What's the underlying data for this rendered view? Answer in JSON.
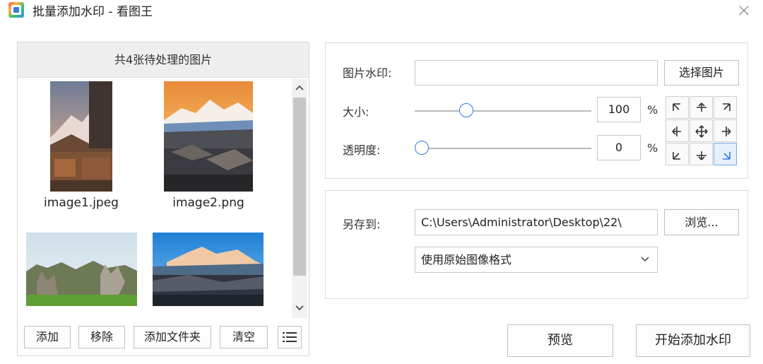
{
  "window": {
    "title": "批量添加水印 - 看图王",
    "close_icon": "close-icon"
  },
  "left": {
    "header": "共4张待处理的图片",
    "images": [
      {
        "name": "image1.jpeg"
      },
      {
        "name": "image2.png"
      },
      {
        "name": ""
      },
      {
        "name": ""
      }
    ],
    "buttons": {
      "add": "添加",
      "remove": "移除",
      "add_folder": "添加文件夹",
      "clear": "清空"
    }
  },
  "watermark": {
    "image_label": "图片水印:",
    "image_value": "",
    "choose_button": "选择图片",
    "size_label": "大小:",
    "size_value": "100",
    "size_percent": 100,
    "opacity_label": "透明度:",
    "opacity_value": "0",
    "opacity_percent": 0,
    "percent_unit": "%",
    "position_selected": 8
  },
  "save": {
    "label": "另存到:",
    "path": "C:\\Users\\Administrator\\Desktop\\22\\",
    "browse_button": "浏览...",
    "format": "使用原始图像格式"
  },
  "actions": {
    "preview": "预览",
    "start": "开始添加水印"
  },
  "colors": {
    "accent": "#2f7be0",
    "header_bg": "#eeeeee"
  }
}
